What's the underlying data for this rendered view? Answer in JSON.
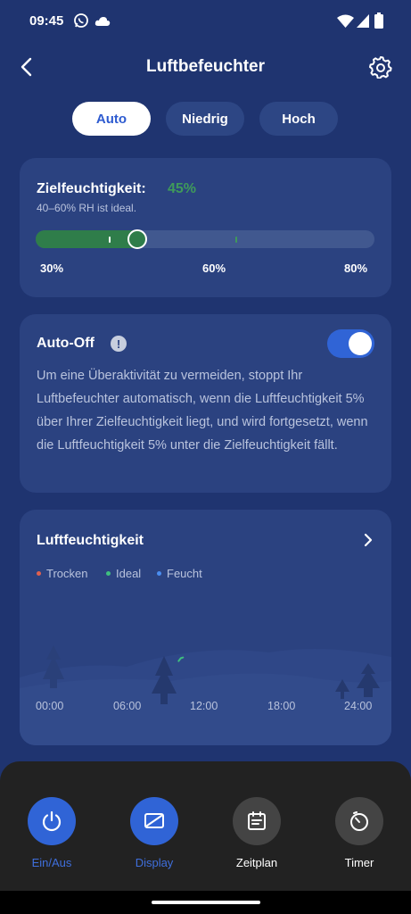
{
  "status_bar": {
    "time": "09:45",
    "left_icons": [
      "whatsapp-icon",
      "cloud-icon"
    ],
    "right_icons": [
      "wifi-icon",
      "signal-icon",
      "battery-icon"
    ]
  },
  "header": {
    "title": "Luftbefeuchter",
    "back_icon": "back-arrow-icon",
    "settings_icon": "gear-icon"
  },
  "modes": {
    "tabs": [
      {
        "label": "Auto",
        "active": true
      },
      {
        "label": "Niedrig",
        "active": false
      },
      {
        "label": "Hoch",
        "active": false
      }
    ]
  },
  "target_humidity": {
    "title": "Zielfeuchtigkeit:",
    "value": "45%",
    "hint": "40–60% RH ist ideal.",
    "slider_fraction": 0.3,
    "scale_labels": [
      "30%",
      "60%",
      "80%"
    ]
  },
  "auto_off": {
    "title": "Auto-Off",
    "info_icon": "info-icon",
    "enabled": true,
    "description": "Um eine Überaktivität zu vermeiden, stoppt Ihr Luftbefeuchter automatisch, wenn die Luftfeuchtigkeit 5% über Ihrer Zielfeuchtigkeit liegt, und wird fortgesetzt, wenn die Luftfeuchtigkeit 5% unter die Zielfeuchtigkeit fällt."
  },
  "humidity_chart": {
    "title": "Luftfeuchtigkeit",
    "chevron_icon": "chevron-right-icon",
    "legend": [
      {
        "label": "Trocken",
        "color": "#e0604e"
      },
      {
        "label": "Ideal",
        "color": "#3fbf7f"
      },
      {
        "label": "Feucht",
        "color": "#4a8df0"
      }
    ]
  },
  "chart_data": {
    "type": "line",
    "title": "Luftfeuchtigkeit",
    "x_tick_labels": [
      "00:00",
      "06:00",
      "12:00",
      "18:00",
      "24:00"
    ],
    "series": [
      {
        "name": "Ideal",
        "color": "#3fbf7f",
        "x": [
          "10:00",
          "10:10",
          "10:20"
        ],
        "y": [
          0.38,
          0.42,
          0.43
        ]
      }
    ],
    "grid": false,
    "legend_position": "top-left"
  },
  "bottom_nav": {
    "items": [
      {
        "label": "Ein/Aus",
        "icon": "power-icon",
        "active": true
      },
      {
        "label": "Display",
        "icon": "display-icon",
        "active": true
      },
      {
        "label": "Zeitplan",
        "icon": "calendar-icon",
        "active": false
      },
      {
        "label": "Timer",
        "icon": "timer-icon",
        "active": false
      }
    ]
  },
  "colors": {
    "background": "#1f3470",
    "card": "#2b4280",
    "accent_blue": "#3064d6",
    "accent_green": "#3f9a5a",
    "bottom_panel": "#222222"
  }
}
